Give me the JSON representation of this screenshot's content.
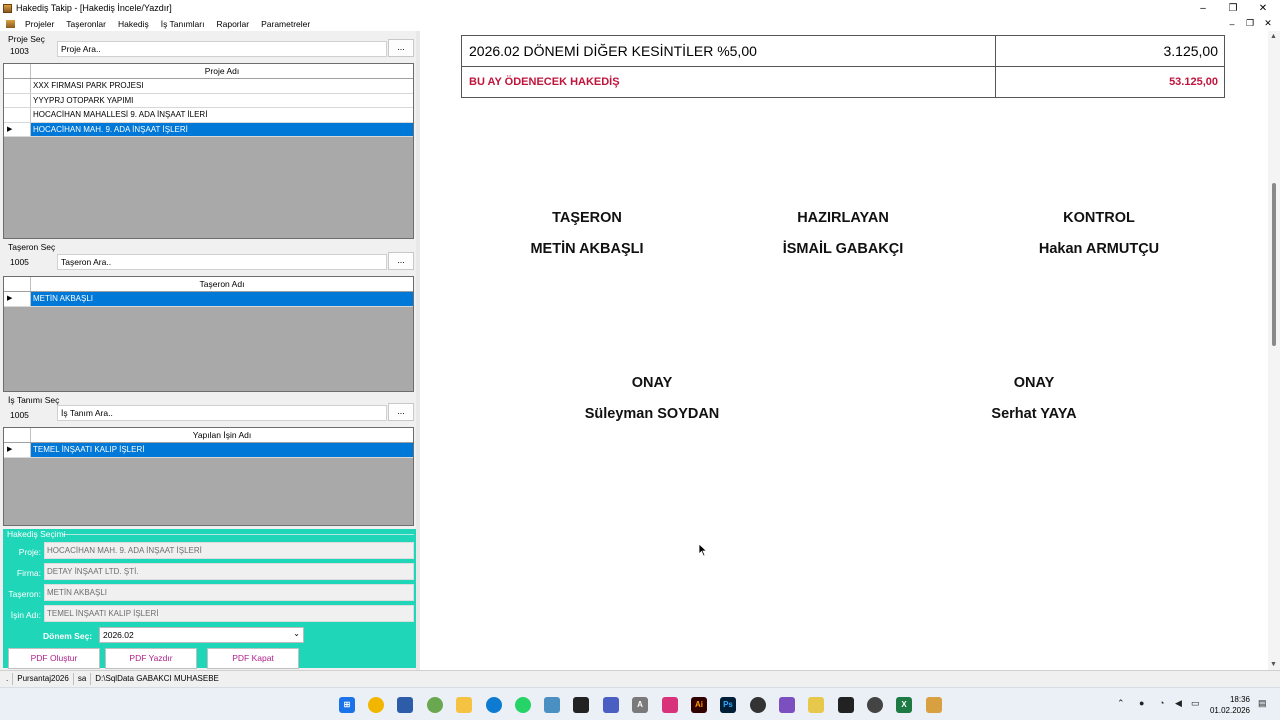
{
  "window": {
    "title": "Hakediş Takip - [Hakediş İncele/Yazdır]",
    "minimize": "–",
    "maximize": "❐",
    "close": "✕"
  },
  "menu": {
    "items": [
      "Projeler",
      "Taşeronlar",
      "Hakediş",
      "İş Tanımları",
      "Raporlar",
      "Parametreler"
    ],
    "mdi_minimize": "–",
    "mdi_restore": "❐",
    "mdi_close": "✕"
  },
  "proje": {
    "label": "Proje Seç",
    "code": "1003",
    "search_placeholder": "Proje Ara..",
    "browse": "...",
    "column": "Proje Adı",
    "rows": [
      "XXX FIRMASI PARK PROJESI",
      "YYYPRJ OTOPARK YAPIMI",
      "HOCACİHAN MAHALLESİ 9. ADA İNŞAAT İLERİ",
      "HOCACİHAN MAH. 9. ADA İNŞAAT İŞLERİ"
    ],
    "selected_index": 3
  },
  "taseron": {
    "label": "Taşeron Seç",
    "code": "1005",
    "search_placeholder": "Taşeron Ara..",
    "browse": "...",
    "column": "Taşeron Adı",
    "rows": [
      "METİN AKBAŞLI"
    ],
    "selected_index": 0
  },
  "is_tanimi": {
    "label": "İş Tanımı Seç",
    "code": "1005",
    "search_placeholder": "İş Tanım Ara..",
    "browse": "...",
    "column": "Yapılan İşin Adı",
    "rows": [
      "TEMEL İNŞAATI KALIP İŞLERİ"
    ],
    "selected_index": 0
  },
  "hakedis_secimi": {
    "legend": "Hakediş Seçimi",
    "proje_label": "Proje:",
    "proje_value": "HOCACİHAN MAH. 9. ADA İNŞAAT İŞLERİ",
    "firma_label": "Firma:",
    "firma_value": "DETAY İNŞAAT LTD. ŞTİ.",
    "taseron_label": "Taşeron:",
    "taseron_value": "METİN AKBAŞLI",
    "isin_label": "İşin Adı:",
    "isin_value": "TEMEL İNŞAATI KALIP İŞLERİ",
    "donem_label": "Dönem Seç:",
    "donem_value": "2026.02",
    "btn_olustur": "PDF Oluştur",
    "btn_yazdir": "PDF Yazdır",
    "btn_kapat": "PDF Kapat"
  },
  "document": {
    "kesinti_label": "2026.02 DÖNEMİ DİĞER KESİNTİLER %5,00",
    "kesinti_value": "3.125,00",
    "odenecek_label": "BU AY ÖDENECEK HAKEDİŞ",
    "odenecek_value": "53.125,00",
    "signatures": [
      {
        "role": "TAŞERON",
        "name": "METİN AKBAŞLI"
      },
      {
        "role": "HAZIRLAYAN",
        "name": "İSMAİL GABAKÇI"
      },
      {
        "role": "KONTROL",
        "name": "Hakan ARMUTÇU"
      },
      {
        "role": "ONAY",
        "name": "Süleyman SOYDAN"
      },
      {
        "role": "ONAY",
        "name": "Serhat YAYA"
      }
    ]
  },
  "statusbar": {
    "dots": ".",
    "db": "Pursantaj2026",
    "user": "sa",
    "path": "D:\\SqlData  GABAKCI  MUHASEBE"
  },
  "taskbar": {
    "time": "18:36",
    "date": "01.02.2026"
  },
  "colors": {
    "selection": "#0078d7",
    "panel_accent": "#1fd6b8",
    "total_red": "#c0143c",
    "button_text": "#b0208a"
  }
}
